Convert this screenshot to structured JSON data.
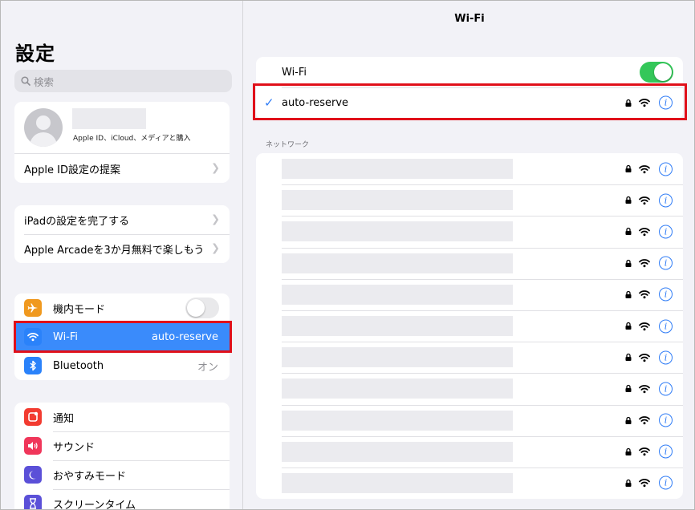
{
  "sidebar": {
    "title": "設定",
    "search_placeholder": "検索",
    "profile": {
      "subtitle": "Apple ID、iCloud、メディアと購入"
    },
    "apple_id_suggestion": "Apple ID設定の提案",
    "setup_group": [
      {
        "label": "iPadの設定を完了する"
      },
      {
        "label": "Apple Arcadeを3か月無料で楽しもう"
      }
    ],
    "connectivity": [
      {
        "label": "機内モード",
        "icon": "airplane-icon",
        "icon_color": "#f0991f",
        "toggle_on": false
      },
      {
        "label": "Wi-Fi",
        "icon": "wifi-icon",
        "icon_color": "#2a82fa",
        "value": "auto-reserve",
        "selected": true
      },
      {
        "label": "Bluetooth",
        "icon": "bluetooth-icon",
        "icon_color": "#2a82fa",
        "value": "オン"
      }
    ],
    "notifications": [
      {
        "label": "通知",
        "icon": "notifications-icon",
        "icon_color": "#f23b30"
      },
      {
        "label": "サウンド",
        "icon": "sound-icon",
        "icon_color": "#f0365a"
      },
      {
        "label": "おやすみモード",
        "icon": "moon-icon",
        "icon_color": "#5b50d8"
      },
      {
        "label": "スクリーンタイム",
        "icon": "hourglass-icon",
        "icon_color": "#5b50d8"
      }
    ]
  },
  "main": {
    "title": "Wi-Fi",
    "wifi_toggle_label": "Wi-Fi",
    "wifi_on": true,
    "connected_network": "auto-reserve",
    "networks_header": "ネットワーク",
    "network_count": 11,
    "accent_color": "#2f7cf6",
    "toggle_on_color": "#34c759",
    "highlight_color": "#e0101a"
  }
}
